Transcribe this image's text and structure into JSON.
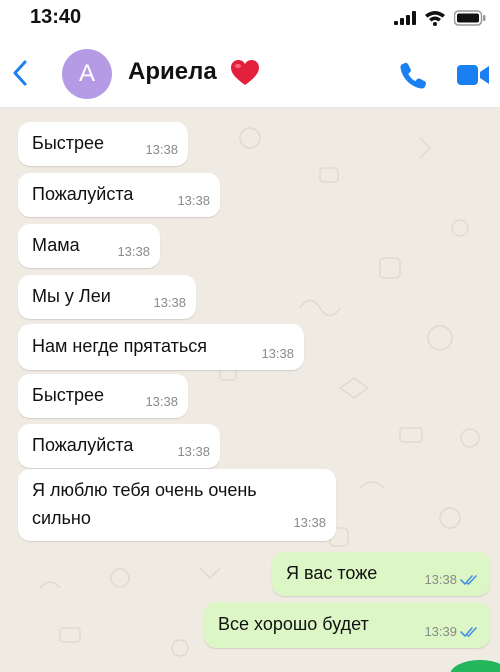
{
  "status_bar": {
    "time": "13:40"
  },
  "header": {
    "avatar_letter": "A",
    "contact_name": "Ариела",
    "colors": {
      "accent": "#1a7ff0",
      "avatar": "#b59ae6",
      "heart": "#e3213d"
    }
  },
  "messages": [
    {
      "direction": "in",
      "text": "Быстрее",
      "time": "13:38"
    },
    {
      "direction": "in",
      "text": "Пожалуйста",
      "time": "13:38"
    },
    {
      "direction": "in",
      "text": "Мама",
      "time": "13:38"
    },
    {
      "direction": "in",
      "text": "Мы у Леи",
      "time": "13:38"
    },
    {
      "direction": "in",
      "text": "Нам негде прятаться",
      "time": "13:38"
    },
    {
      "direction": "in",
      "text": "Быстрее",
      "time": "13:38"
    },
    {
      "direction": "in",
      "text": "Пожалуйста",
      "time": "13:38"
    },
    {
      "direction": "in",
      "text_line1": "Я люблю тебя очень очень",
      "text_line2": "сильно",
      "time": "13:38"
    },
    {
      "direction": "out",
      "text": "Я вас тоже",
      "time": "13:38",
      "status": "read"
    },
    {
      "direction": "out",
      "text": "Все хорошо будет",
      "time": "13:39",
      "status": "read"
    }
  ]
}
